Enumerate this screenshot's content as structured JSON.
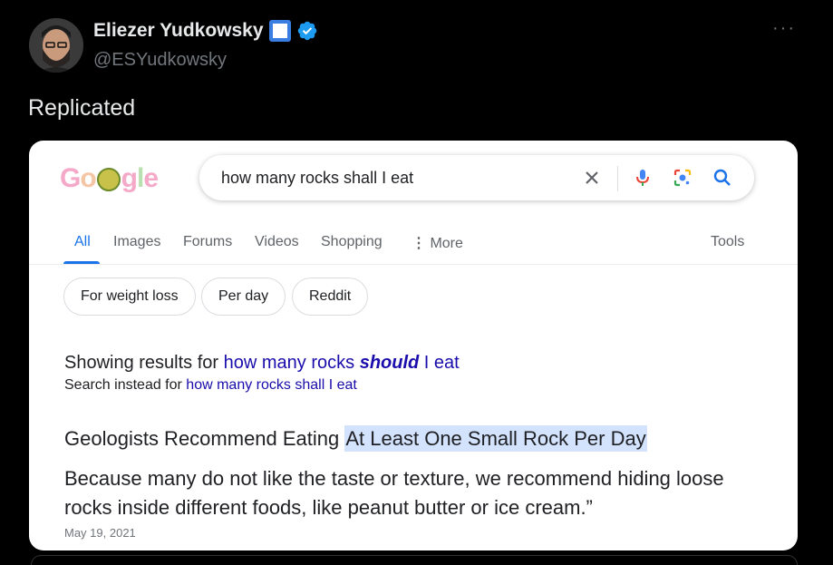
{
  "tweet": {
    "author_name": "Eliezer Yudkowsky",
    "handle": "@ESYudkowsky",
    "more_glyph": "···",
    "text": "Replicated"
  },
  "google": {
    "logo": {
      "g1": "G",
      "o1": "o",
      "g2": "g",
      "l": "l",
      "e": "e"
    },
    "search_query": "how many rocks shall I eat",
    "tabs": [
      "All",
      "Images",
      "Forums",
      "Videos",
      "Shopping",
      "More",
      "Tools"
    ],
    "chips": [
      "For weight loss",
      "Per day",
      "Reddit"
    ],
    "showing_prefix": "Showing results for ",
    "showing_link_1": "how many rocks ",
    "showing_link_bold": "should",
    "showing_link_2": " I eat",
    "instead_prefix": "Search instead for ",
    "instead_link": "how many rocks shall I eat",
    "headline_prefix": "Geologists Recommend Eating ",
    "headline_highlight": "At Least One Small Rock Per Day",
    "body": "Because many do not like the taste or texture, we recommend hiding loose rocks inside different foods, like peanut butter or ice cream.”",
    "date": "May 19, 2021"
  },
  "colors": {
    "verified_blue": "#1d9bf0",
    "google_blue": "#1a73e8",
    "link_blue": "#1a0dab",
    "highlight": "#d3e3fd"
  }
}
